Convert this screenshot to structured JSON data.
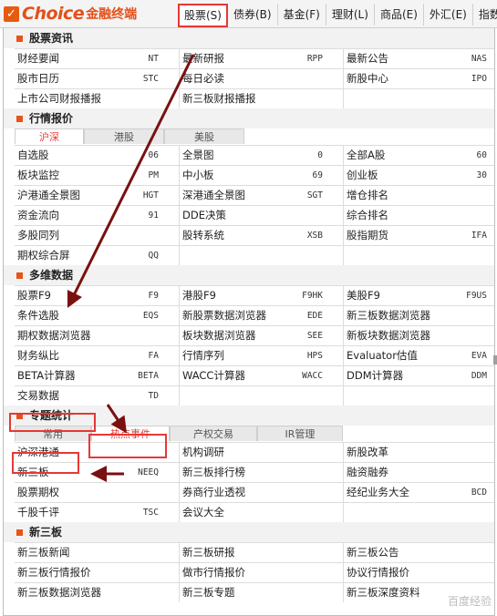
{
  "app": {
    "brand": "Choice",
    "brand_suffix": "金融终端"
  },
  "top_menu": [
    "股票(S)",
    "债券(B)",
    "基金(F)",
    "理财(L)",
    "商品(E)",
    "外汇(E)",
    "指数"
  ],
  "sections": {
    "stock_info": {
      "title": "股票资讯",
      "rows": [
        [
          [
            "财经要闻",
            "NT"
          ],
          [
            "最新研报",
            "RPP"
          ],
          [
            "最新公告",
            "NAS"
          ]
        ],
        [
          [
            "股市日历",
            "STC"
          ],
          [
            "每日必读",
            ""
          ],
          [
            "新股中心",
            "IPO"
          ]
        ],
        [
          [
            "上市公司财报播报",
            ""
          ],
          [
            "新三板财报播报",
            ""
          ],
          [
            "",
            ""
          ]
        ]
      ]
    },
    "quotes": {
      "title": "行情报价",
      "tabs": [
        "沪深",
        "港股",
        "美股"
      ],
      "rows": [
        [
          [
            "自选股",
            "06"
          ],
          [
            "全景图",
            "0"
          ],
          [
            "全部A股",
            "60"
          ]
        ],
        [
          [
            "板块监控",
            "PM"
          ],
          [
            "中小板",
            "69"
          ],
          [
            "创业板",
            "30"
          ]
        ],
        [
          [
            "沪港通全景图",
            "HGT"
          ],
          [
            "深港通全景图",
            "SGT"
          ],
          [
            "增仓排名",
            ""
          ]
        ],
        [
          [
            "资金流向",
            "91"
          ],
          [
            "DDE决策",
            ""
          ],
          [
            "综合排名",
            ""
          ]
        ],
        [
          [
            "多股同列",
            ""
          ],
          [
            "股转系统",
            "XSB"
          ],
          [
            "股指期货",
            "IFA"
          ]
        ],
        [
          [
            "期权综合屏",
            "QQ"
          ],
          [
            "",
            ""
          ],
          [
            "",
            ""
          ]
        ]
      ]
    },
    "multi": {
      "title": "多维数据",
      "rows": [
        [
          [
            "股票F9",
            "F9"
          ],
          [
            "港股F9",
            "F9HK"
          ],
          [
            "美股F9",
            "F9US"
          ]
        ],
        [
          [
            "条件选股",
            "EQS"
          ],
          [
            "新股票数据浏览器",
            "EDE"
          ],
          [
            "新三板数据浏览器",
            ""
          ]
        ],
        [
          [
            "期权数据浏览器",
            ""
          ],
          [
            "板块数据浏览器",
            "SEE"
          ],
          [
            "新板块数据浏览器",
            ""
          ]
        ],
        [
          [
            "财务纵比",
            "FA"
          ],
          [
            "行情序列",
            "HPS"
          ],
          [
            "Evaluator估值",
            "EVA"
          ]
        ],
        [
          [
            "BETA计算器",
            "BETA"
          ],
          [
            "WACC计算器",
            "WACC"
          ],
          [
            "DDM计算器",
            "DDM"
          ]
        ],
        [
          [
            "交易数据",
            "TD"
          ],
          [
            "",
            ""
          ],
          [
            "",
            ""
          ]
        ]
      ]
    },
    "topics": {
      "title": "专题统计",
      "tabs": [
        "常用",
        "热点事件",
        "产权交易",
        "IR管理"
      ],
      "rows": [
        [
          [
            "沪深港通",
            ""
          ],
          [
            "机构调研",
            ""
          ],
          [
            "新股改革",
            ""
          ]
        ],
        [
          [
            "新三板",
            "NEEQ"
          ],
          [
            "新三板排行榜",
            ""
          ],
          [
            "融资融券",
            ""
          ]
        ],
        [
          [
            "股票期权",
            ""
          ],
          [
            "券商行业透视",
            ""
          ],
          [
            "经纪业务大全",
            "BCD"
          ]
        ],
        [
          [
            "千股千评",
            "TSC"
          ],
          [
            "会议大全",
            ""
          ],
          [
            "",
            ""
          ]
        ]
      ]
    },
    "neeq": {
      "title": "新三板",
      "rows": [
        [
          [
            "新三板新闻",
            ""
          ],
          [
            "新三板研报",
            ""
          ],
          [
            "新三板公告",
            ""
          ]
        ],
        [
          [
            "新三板行情报价",
            ""
          ],
          [
            "做市行情报价",
            ""
          ],
          [
            "协议行情报价",
            ""
          ]
        ],
        [
          [
            "新三板数据浏览器",
            ""
          ],
          [
            "新三板专题",
            ""
          ],
          [
            "新三板深度资料",
            ""
          ]
        ]
      ]
    }
  },
  "watermark": "百度经验",
  "colors": {
    "accent": "#e53935",
    "brand": "#e3501a",
    "arrow": "#7a1010"
  }
}
